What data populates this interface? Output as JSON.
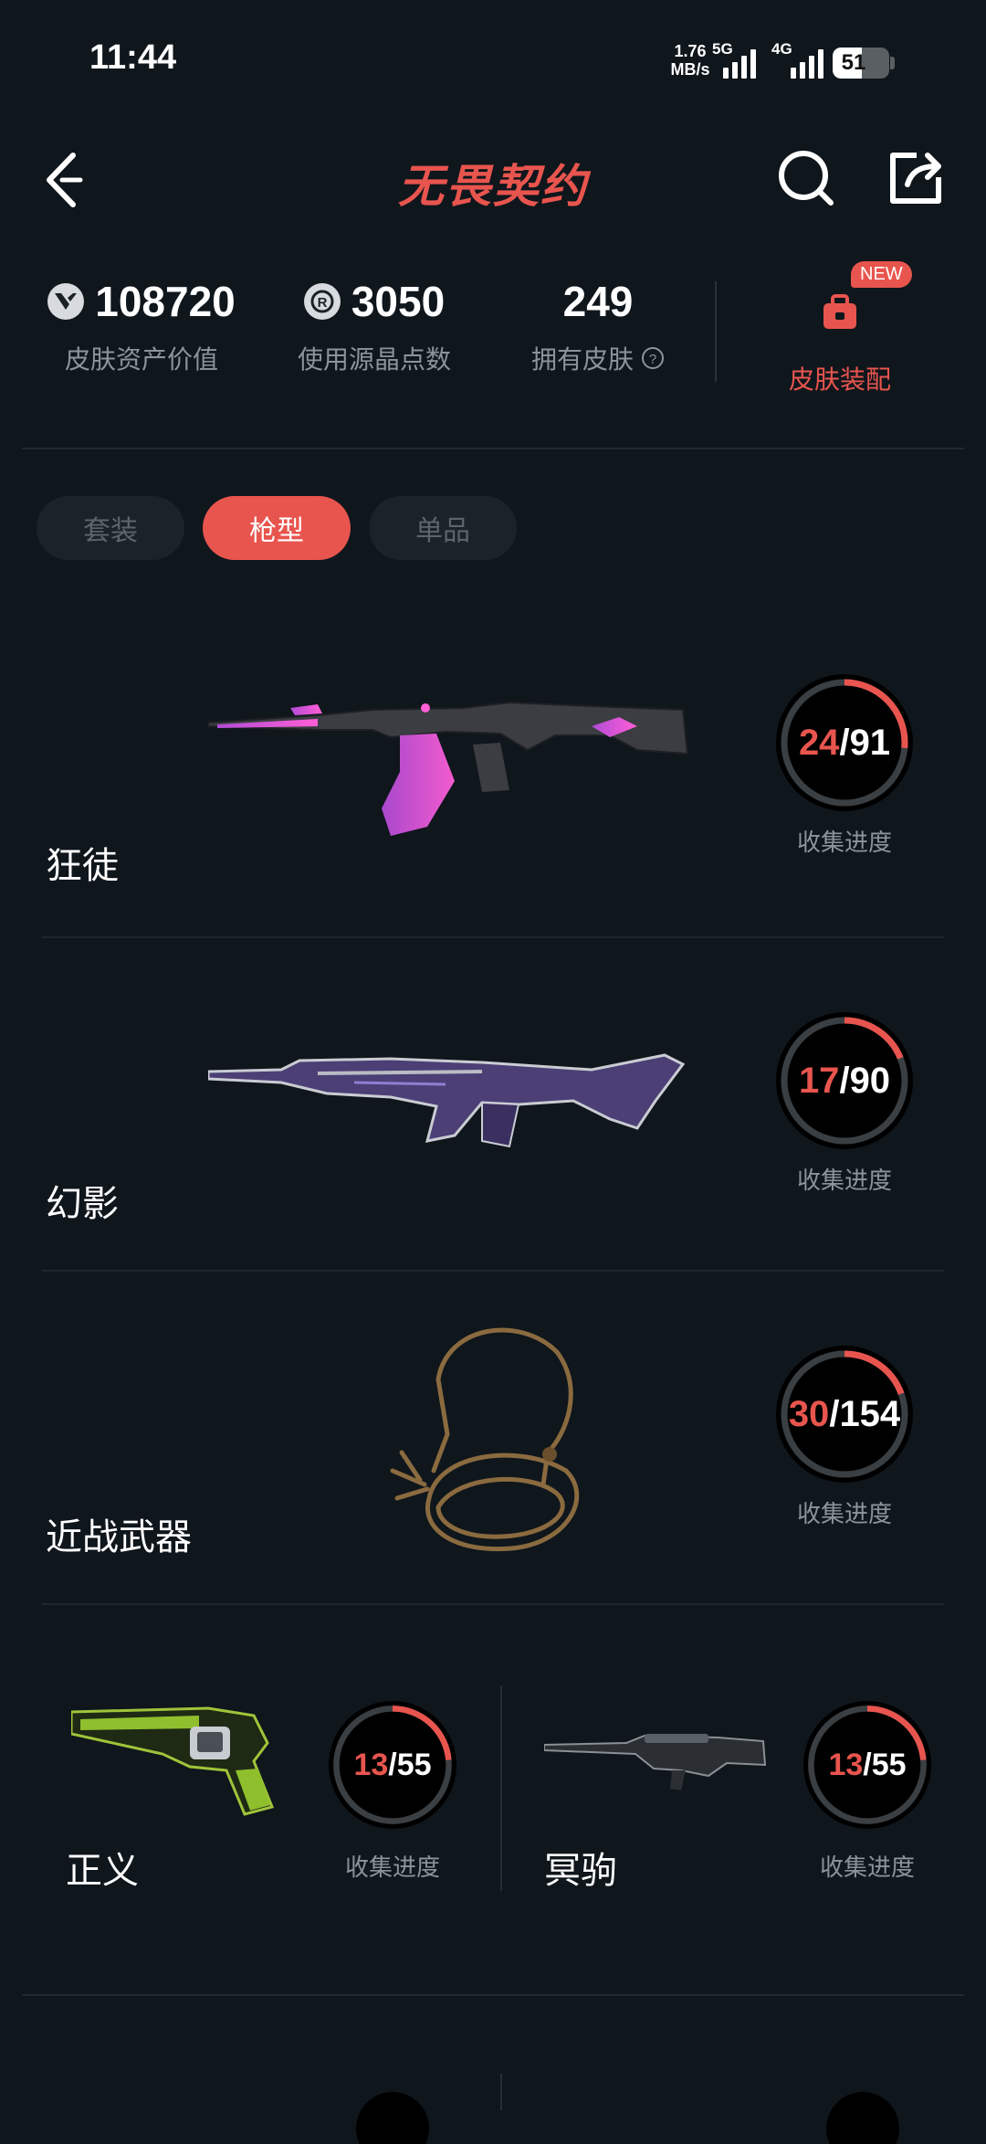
{
  "status_bar": {
    "time": "11:44",
    "speed_value": "1.76",
    "speed_unit": "MB/s",
    "net1": "5G",
    "net2": "4G",
    "battery": "51",
    "battery_level": 0.51
  },
  "header": {
    "title": "无畏契约",
    "back_icon": "chevron-left-icon",
    "search_icon": "search-icon",
    "share_icon": "share-icon"
  },
  "stats": [
    {
      "value": "108720",
      "label": "皮肤资产价值",
      "icon": "valorant-logo-icon"
    },
    {
      "value": "3050",
      "label": "使用源晶点数",
      "icon": "radianite-icon"
    },
    {
      "value": "249",
      "label": "拥有皮肤",
      "icon": "help-icon"
    }
  ],
  "outfit": {
    "label": "皮肤装配",
    "badge": "NEW"
  },
  "tabs": [
    {
      "label": "套装",
      "active": false
    },
    {
      "label": "枪型",
      "active": true
    },
    {
      "label": "单品",
      "active": false
    }
  ],
  "progress_label": "收集进度",
  "weapons": [
    {
      "name": "狂徒",
      "have": "24",
      "total": "91",
      "progress": 0.264
    },
    {
      "name": "幻影",
      "have": "17",
      "total": "90",
      "progress": 0.189
    },
    {
      "name": "近战武器",
      "have": "30",
      "total": "154",
      "progress": 0.195
    },
    {
      "name": "正义",
      "have": "13",
      "total": "55",
      "progress": 0.236
    },
    {
      "name": "冥驹",
      "have": "13",
      "total": "55",
      "progress": 0.236
    }
  ],
  "colors": {
    "accent": "#e8554e",
    "background": "#0f161c",
    "muted": "#8c949b"
  }
}
